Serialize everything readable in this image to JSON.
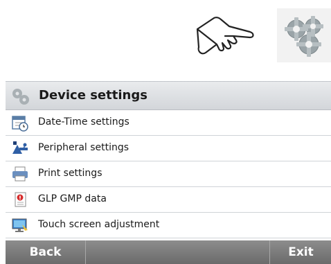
{
  "header": {
    "tap_icon": "pointing-hand-icon",
    "settings_icon": "gears-icon"
  },
  "panel": {
    "title": "Device settings",
    "title_icon": "gears-icon",
    "items": [
      {
        "label": "Date-Time settings",
        "icon": "calendar-clock-icon"
      },
      {
        "label": "Peripheral settings",
        "icon": "usb-icon"
      },
      {
        "label": "Print settings",
        "icon": "printer-icon"
      },
      {
        "label": "GLP GMP data",
        "icon": "document-icon"
      },
      {
        "label": "Touch screen adjustment",
        "icon": "monitor-icon"
      }
    ]
  },
  "footer": {
    "back_label": "Back",
    "middle_label": "",
    "exit_label": "Exit"
  },
  "colors": {
    "title_bar": "#d9dcdf",
    "footer": "#7a7a7a"
  }
}
